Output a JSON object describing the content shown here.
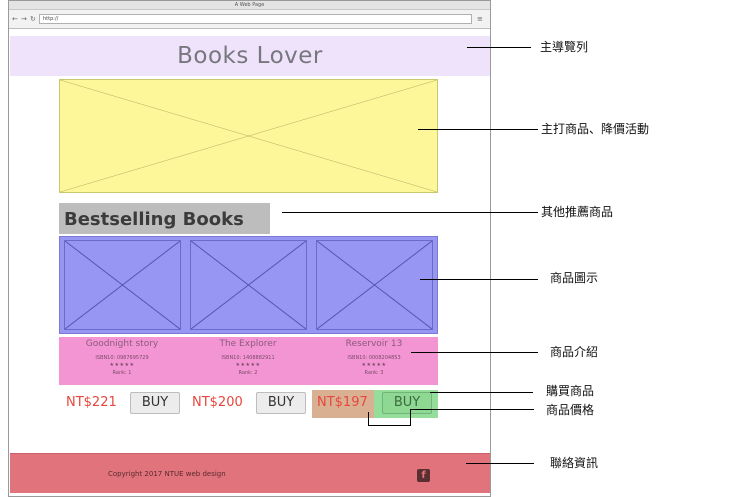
{
  "browser": {
    "window_title": "A Web Page",
    "nav_buttons": [
      "←",
      "→",
      "↻"
    ],
    "address": "http://",
    "menu_icon": "≡"
  },
  "header": {
    "title": "Books Lover"
  },
  "hero": {
    "placeholder_icon": "x-placeholder"
  },
  "bestselling": {
    "heading": "Bestselling Books"
  },
  "products": [
    {
      "title": "Goodnight story",
      "isbn": "ISBN10: 0987695729",
      "stars": "★★★★★",
      "rank": "Rank: 1",
      "price": "NT$221",
      "buy_label": "BUY"
    },
    {
      "title": "The Explorer",
      "isbn": "ISBN10: 1408882911",
      "stars": "★★★★★",
      "rank": "Rank: 2",
      "price": "NT$200",
      "buy_label": "BUY"
    },
    {
      "title": "Reservoir 13",
      "isbn": "ISBN10: 0008204853",
      "stars": "★★★★★",
      "rank": "Rank: 3",
      "price": "NT$197",
      "buy_label": "BUY"
    }
  ],
  "footer": {
    "copyright": "Copyright 2017 NTUE web design",
    "facebook_icon": "f"
  },
  "annotations": {
    "nav": "主導覽列",
    "featured": "主打商品、降價活動",
    "recommend": "其他推薦商品",
    "images": "商品圖示",
    "intro": "商品介紹",
    "buy": "購買商品",
    "price": "商品價格",
    "contact": "聯絡資訊"
  },
  "colors": {
    "header_bg": "#efe3fb",
    "hero_bg": "#fdf79a",
    "products_bg": "#9797f3",
    "info_bg": "#f495d3",
    "footer_bg": "#e1737c",
    "price_text": "#e5473f",
    "buy_highlight": "#94dd9a",
    "price_highlight": "#d9b192"
  }
}
